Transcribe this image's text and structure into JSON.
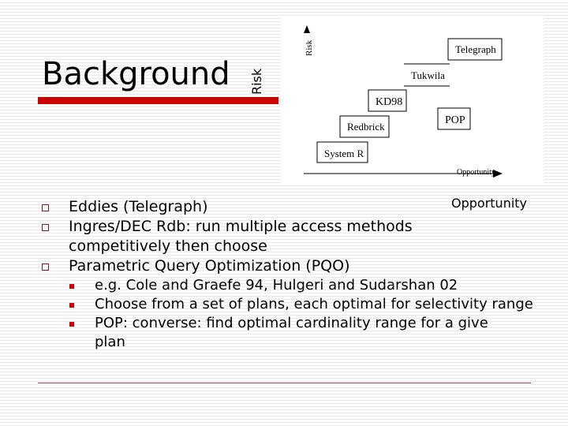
{
  "slide": {
    "title": "Background",
    "risk_label": "Risk",
    "opportunity_label": "Opportunity",
    "bullets": [
      {
        "text": "Eddies (Telegraph)"
      },
      {
        "text": "Ingres/DEC Rdb: run multiple access methods competitively then choose"
      },
      {
        "text": "Parametric Query Optimization (PQO)",
        "children": [
          "e.g. Cole and Graefe 94, Hulgeri and Sudarshan 02",
          "Choose from a set of plans, each optimal for selectivity range",
          "POP: converse: find optimal cardinality range for a give plan"
        ]
      }
    ]
  },
  "figure": {
    "y_axis_label": "Risk",
    "x_axis_label": "Opportunity",
    "systems": [
      "Telegraph",
      "Tukwila",
      "KD98",
      "POP",
      "Redbrick",
      "System R"
    ]
  },
  "colors": {
    "accent": "#cc0000",
    "bullet_outline": "#8b1a2a"
  }
}
